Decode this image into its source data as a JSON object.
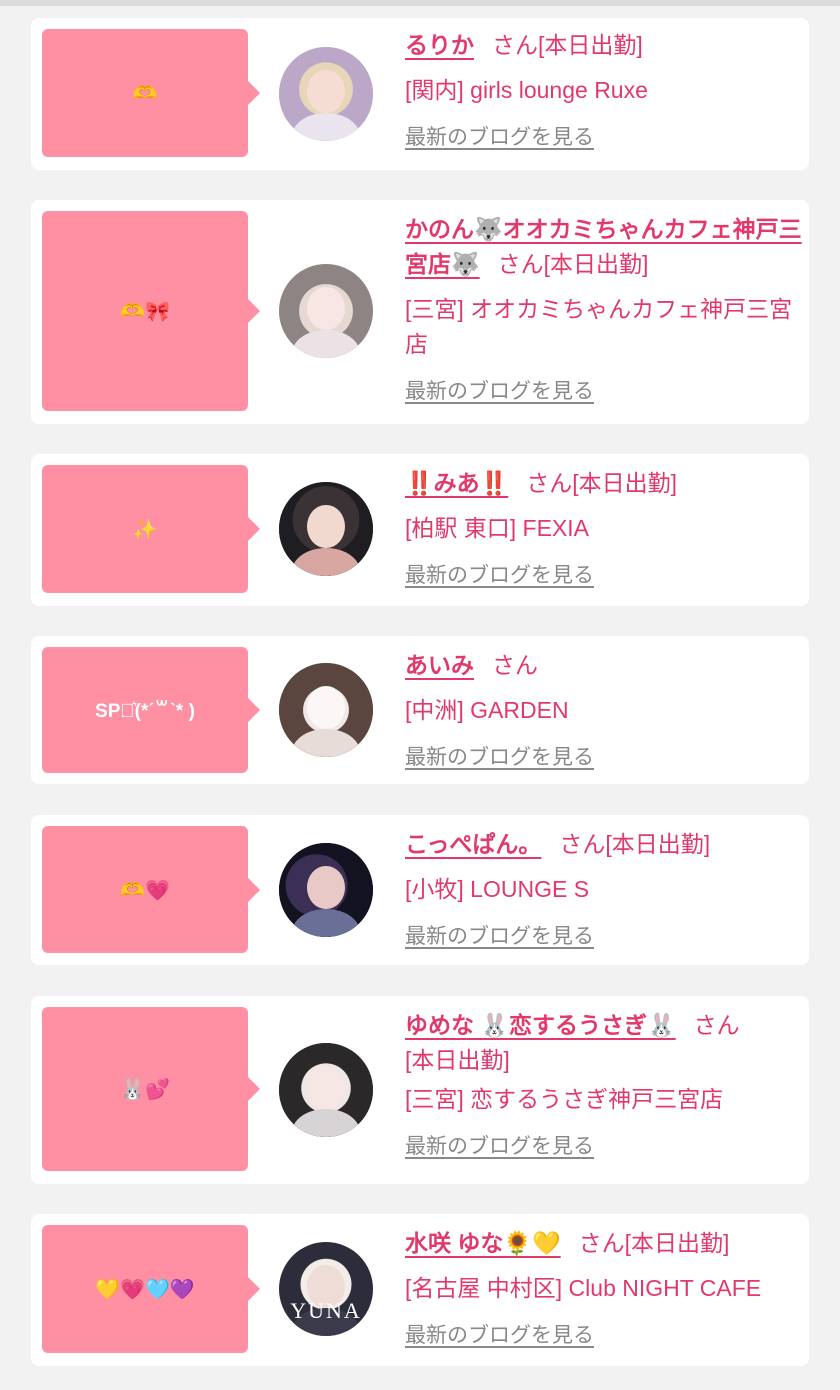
{
  "entries": [
    {
      "bubble": "🫶",
      "name": "るりか",
      "san": "さん",
      "status": "[本日出勤]",
      "store": "[関内] girls lounge Ruxe",
      "blog": "最新のブログを見る"
    },
    {
      "bubble": "🫶🎀",
      "name": "かのん🐺オオカミちゃんカフェ神戸三宮店🐺",
      "san": "さん",
      "status": "[本日出勤]",
      "store": "[三宮] オオカミちゃんカフェ神戸三宮店",
      "blog": "最新のブログを見る"
    },
    {
      "bubble": "✨",
      "name": "‼️みあ‼️",
      "san": "さん",
      "status": "[本日出勤]",
      "store": "[柏駅 東口] FEXIA",
      "blog": "最新のブログを見る"
    },
    {
      "bubble": "SP⋆͛(*ˊ꒳ˋ* )",
      "name": "あいみ",
      "san": "さん",
      "status": "",
      "store": "[中洲] GARDEN",
      "blog": "最新のブログを見る"
    },
    {
      "bubble": "🫶💗",
      "name": "こっぺぱん。",
      "san": "さん",
      "status": "[本日出勤]",
      "store": "[小牧] LOUNGE S",
      "blog": "最新のブログを見る"
    },
    {
      "bubble": "🐰💕",
      "name": "ゆめな 🐰恋するうさぎ🐰",
      "san": "さん",
      "status": "[本日出勤]",
      "store": "[三宮] 恋するうさぎ神戸三宮店",
      "blog": "最新のブログを見る"
    },
    {
      "bubble": "💛💗🩵💜",
      "name": "水咲 ゆな🌻💛",
      "san": "さん",
      "status": "[本日出勤]",
      "store": "[名古屋 中村区] Club NIGHT CAFE",
      "blog": "最新のブログを見る",
      "avatar_text": "YUNA"
    }
  ],
  "colors": {
    "accent": "#e0396a",
    "bubble": "#ff8fa3",
    "link_gray": "#888888",
    "background": "#f2f2f2"
  }
}
